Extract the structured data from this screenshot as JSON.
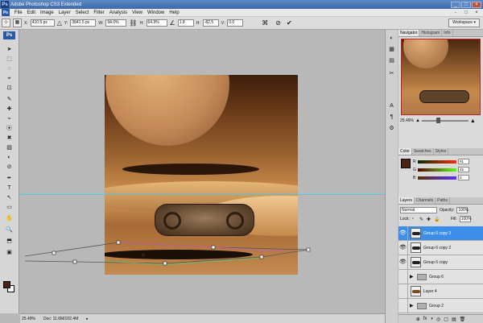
{
  "window": {
    "title": "Adobe Photoshop CS3 Extended",
    "min": "_",
    "max": "□",
    "close": "×"
  },
  "menu": {
    "logo": "Ps",
    "items": [
      "File",
      "Edit",
      "Image",
      "Layer",
      "Select",
      "Filter",
      "Analysis",
      "View",
      "Window",
      "Help"
    ],
    "doc_min": "-",
    "doc_restore": "□",
    "doc_close": "×"
  },
  "options": {
    "x_label": "X:",
    "x_value": "410.5 px",
    "y_label": "Y:",
    "y_value": "3841.5 px",
    "w_label": "W:",
    "w_value": "94.0%",
    "h_label": "H:",
    "h_value": "64.9%",
    "angle_value": "1.8",
    "hskew_label": "H:",
    "hskew_value": "-82.5",
    "vskew_label": "V:",
    "vskew_value": "0.0",
    "cancel_glyph": "⊘",
    "commit_glyph": "✔",
    "workspace_label": "Workspace ▾"
  },
  "tools": {
    "logo": "Ps",
    "glyphs": [
      "➤",
      "⬚",
      "◌",
      "⌖",
      "⊡",
      "✎",
      "✚",
      "⌁",
      "⦿",
      "✖",
      "▨",
      "◐",
      "⊘",
      "✒",
      "T",
      "↖",
      "▭",
      "✋",
      "🔍",
      "⬒",
      "▣"
    ]
  },
  "status": {
    "zoom": "25.49%",
    "doc": "Doc: 11.6M/102.4M",
    "arrow": "▸"
  },
  "strip": {
    "glyphs": [
      "◐",
      "▦",
      "▤",
      "✂",
      "A",
      "¶",
      "⚙"
    ]
  },
  "panels": {
    "navigator": {
      "tabs": [
        "Navigator",
        "Histogram",
        "Info"
      ],
      "zoom": "25.49%"
    },
    "color": {
      "tabs": [
        "Color",
        "Swatches",
        "Styles"
      ],
      "rows": [
        {
          "label": "R",
          "value": "91"
        },
        {
          "label": "G",
          "value": "45"
        },
        {
          "label": "B",
          "value": "0"
        }
      ]
    },
    "layers": {
      "tabs": [
        "Layers",
        "Channels",
        "Paths"
      ],
      "blend_mode": "Normal",
      "opacity_label": "Opacity:",
      "opacity_value": "100%",
      "lock_label": "Lock:",
      "fill_label": "Fill:",
      "fill_value": "100%",
      "rows": [
        {
          "name": "Group 6 copy 3",
          "visible": true,
          "selected": true,
          "kind": "layer"
        },
        {
          "name": "Group 6 copy 2",
          "visible": true,
          "selected": false,
          "kind": "layer"
        },
        {
          "name": "Group 6 copy",
          "visible": true,
          "selected": false,
          "kind": "layer"
        },
        {
          "name": "Group 6",
          "visible": false,
          "selected": false,
          "kind": "group"
        },
        {
          "name": "Layer 4",
          "visible": false,
          "selected": false,
          "kind": "layer"
        },
        {
          "name": "Group 2",
          "visible": false,
          "selected": false,
          "kind": "group"
        }
      ],
      "footer_glyphs": [
        "⊕",
        "fx",
        "◑",
        "◎",
        "▢",
        "▤",
        "🗑"
      ]
    }
  },
  "colors": {
    "accent": "#3d8ee8",
    "guide": "#52c6e0",
    "foreground": "#4a2410"
  }
}
